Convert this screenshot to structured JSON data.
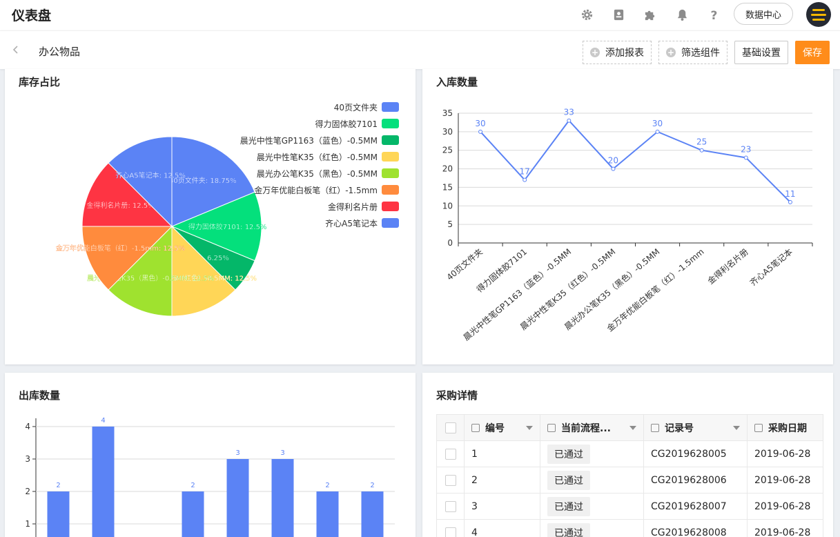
{
  "header": {
    "title": "仪表盘",
    "icons": [
      "gear-icon",
      "contact-book-icon",
      "puzzle-icon",
      "bell-icon",
      "help-icon"
    ],
    "data_center_label": "数据中心",
    "avatar_icon": "menu-lines-icon"
  },
  "toolbar": {
    "page_title": "办公物品",
    "add_report_label": "添加报表",
    "filter_label": "筛选组件",
    "settings_label": "基础设置",
    "save_label": "保存"
  },
  "colors": {
    "accent": "#ff8c1a",
    "chart_blue": "#5b83f5"
  },
  "pie_card": {
    "title": "库存占比",
    "chart_data": {
      "type": "pie",
      "slices": [
        {
          "name": "40页文件夹",
          "value": 18.75,
          "color": "#5b83f5",
          "label": "40页文件夹: 18.75%"
        },
        {
          "name": "得力固体胶7101",
          "value": 12.5,
          "color": "#04e07c",
          "label": "得力固体胶7101: 12.5%"
        },
        {
          "name": "晨光中性笔GP1163（蓝色）-0.5MM",
          "value": 6.25,
          "color": "#04b769",
          "label": "6.25%"
        },
        {
          "name": "晨光中性笔K35（红色）-0.5MM",
          "value": 12.5,
          "color": "#ffd657",
          "label": "晨光中性笔K35（红色）-0.5MM: 12.5%"
        },
        {
          "name": "晨光办公笔K35（黑色）-0.5MM",
          "value": 12.5,
          "color": "#9fe22f",
          "label": "晨光办公笔K35（黑色）-0.5MM: 12.5%"
        },
        {
          "name": "金万年优能白板笔（红）-1.5mm",
          "value": 12.5,
          "color": "#ff8b3d",
          "label": "金万年优能白板笔（红）-1.5mm: 12.5%"
        },
        {
          "name": "金得利名片册",
          "value": 12.5,
          "color": "#fe3443",
          "label": "金得利名片册: 12.5%"
        },
        {
          "name": "齐心A5笔记本",
          "value": 12.5,
          "color": "#5b83f5",
          "label": "齐心A5笔记本: 12.5%"
        }
      ],
      "legend": "top-right"
    }
  },
  "line_card": {
    "title": "入库数量",
    "chart_data": {
      "type": "line",
      "categories": [
        "40页文件夹",
        "得力固体胶7101",
        "晨光中性笔GP1163（蓝色）-0.5MM",
        "晨光中性笔K35（红色）-0.5MM",
        "晨光办公笔K35（黑色）-0.5MM",
        "金万年优能白板笔（红）-1.5mm",
        "金得利名片册",
        "齐心A5笔记本"
      ],
      "values": [
        30,
        17,
        33,
        20,
        30,
        25,
        23,
        11
      ],
      "ylim": [
        0,
        35
      ],
      "yticks": [
        0,
        5,
        10,
        15,
        20,
        25,
        30,
        35
      ],
      "grid": true
    }
  },
  "bar_card": {
    "title": "出库数量",
    "chart_data": {
      "type": "bar",
      "values": [
        2,
        4,
        0,
        2,
        3,
        3,
        2,
        2
      ],
      "bar_labels": [
        "2",
        "4",
        "",
        "2",
        "3",
        "3",
        "2",
        "2"
      ],
      "yticks": [
        1,
        2,
        3,
        4
      ],
      "grid": true
    }
  },
  "table_card": {
    "title": "采购详情",
    "columns": [
      "编号",
      "当前流程...",
      "记录号",
      "采购日期"
    ],
    "rows": [
      {
        "id": "1",
        "status": "已通过",
        "record": "CG2019628005",
        "date": "2019-06-28"
      },
      {
        "id": "2",
        "status": "已通过",
        "record": "CG2019628006",
        "date": "2019-06-28"
      },
      {
        "id": "3",
        "status": "已通过",
        "record": "CG2019628007",
        "date": "2019-06-28"
      },
      {
        "id": "4",
        "status": "已通过",
        "record": "CG2019628008",
        "date": "2019-06-28"
      }
    ]
  }
}
